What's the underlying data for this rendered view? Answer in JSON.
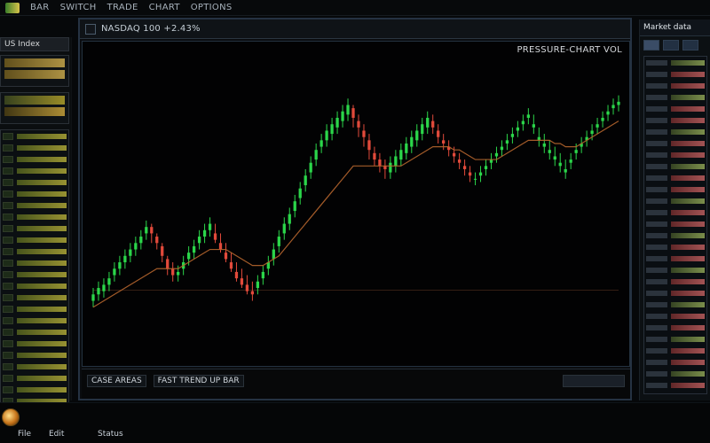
{
  "menubar": {
    "items": [
      "BAR",
      "SWITCH",
      "TRADE",
      "CHART",
      "OPTIONS"
    ]
  },
  "left_panel": {
    "header": "US Index",
    "watchlist_rows": 24
  },
  "chart_window": {
    "title": "NASDAQ 100  +2.43%",
    "overlay_label": "PRESSURE-CHART VOL",
    "footer_left": "CASE AREAS",
    "footer_mid": "FAST TREND UP BAR",
    "footer_right": ""
  },
  "right_panel": {
    "header": "Market data",
    "tab_count": 3,
    "rows": 29
  },
  "taskbar": {
    "items": [
      "File",
      "Edit",
      "Status"
    ]
  },
  "colors": {
    "bull": "#2bd64a",
    "bear": "#e24a3b",
    "ma": "#b5652e",
    "base": "#4a2a1b",
    "window_border": "#253242"
  },
  "chart_data": {
    "type": "candlestick",
    "x": [
      1,
      2,
      3,
      4,
      5,
      6,
      7,
      8,
      9,
      10,
      11,
      12,
      13,
      14,
      15,
      16,
      17,
      18,
      19,
      20,
      21,
      22,
      23,
      24,
      25,
      26,
      27,
      28,
      29,
      30,
      31,
      32,
      33,
      34,
      35,
      36,
      37,
      38,
      39,
      40,
      41,
      42,
      43,
      44,
      45,
      46,
      47,
      48,
      49,
      50,
      51,
      52,
      53,
      54,
      55,
      56,
      57,
      58,
      59,
      60,
      61,
      62,
      63,
      64,
      65,
      66,
      67,
      68,
      69,
      70,
      71,
      72,
      73,
      74,
      75,
      76,
      77,
      78,
      79,
      80,
      81,
      82,
      83,
      84,
      85,
      86,
      87,
      88,
      89,
      90,
      91,
      92,
      93,
      94,
      95,
      96,
      97,
      98,
      99,
      100
    ],
    "open": [
      42,
      44,
      45,
      47,
      50,
      52,
      54,
      56,
      58,
      60,
      63,
      65,
      62,
      59,
      55,
      52,
      50,
      52,
      55,
      57,
      60,
      62,
      64,
      63,
      60,
      57,
      54,
      51,
      49,
      47,
      45,
      46,
      49,
      52,
      55,
      59,
      63,
      66,
      70,
      74,
      78,
      82,
      86,
      90,
      92,
      94,
      96,
      98,
      100,
      102,
      98,
      95,
      92,
      88,
      86,
      84,
      82,
      84,
      86,
      88,
      90,
      92,
      94,
      96,
      98,
      95,
      92,
      90,
      88,
      86,
      84,
      82,
      80,
      81,
      83,
      85,
      87,
      89,
      91,
      93,
      95,
      97,
      99,
      96,
      92,
      90,
      88,
      86,
      84,
      82,
      85,
      88,
      90,
      92,
      94,
      96,
      98,
      100,
      102,
      103
    ],
    "close": [
      44,
      46,
      47,
      49,
      52,
      54,
      56,
      58,
      60,
      62,
      65,
      63,
      60,
      56,
      52,
      50,
      51,
      54,
      57,
      59,
      62,
      64,
      66,
      61,
      58,
      55,
      52,
      49,
      47,
      45,
      44,
      48,
      51,
      54,
      58,
      62,
      66,
      69,
      73,
      77,
      81,
      85,
      89,
      92,
      95,
      97,
      99,
      101,
      103,
      99,
      96,
      93,
      89,
      86,
      84,
      83,
      85,
      87,
      89,
      91,
      93,
      95,
      97,
      99,
      96,
      93,
      91,
      89,
      87,
      85,
      83,
      81,
      80,
      82,
      84,
      86,
      88,
      90,
      92,
      94,
      96,
      98,
      100,
      97,
      93,
      91,
      89,
      87,
      85,
      83,
      86,
      89,
      91,
      93,
      95,
      97,
      99,
      101,
      103,
      104
    ],
    "high": [
      46,
      48,
      49,
      51,
      54,
      56,
      58,
      60,
      62,
      64,
      67,
      66,
      63,
      60,
      56,
      54,
      53,
      56,
      59,
      61,
      64,
      66,
      68,
      66,
      63,
      60,
      57,
      54,
      52,
      50,
      48,
      50,
      53,
      56,
      60,
      64,
      68,
      71,
      75,
      79,
      83,
      87,
      91,
      94,
      97,
      99,
      101,
      103,
      105,
      103,
      100,
      97,
      94,
      90,
      88,
      86,
      87,
      89,
      91,
      93,
      95,
      97,
      99,
      101,
      100,
      97,
      94,
      92,
      90,
      88,
      86,
      84,
      82,
      84,
      86,
      88,
      90,
      92,
      94,
      96,
      98,
      100,
      102,
      100,
      96,
      94,
      92,
      90,
      88,
      86,
      88,
      91,
      93,
      95,
      97,
      99,
      101,
      103,
      105,
      106
    ],
    "low": [
      40,
      42,
      43,
      45,
      48,
      50,
      52,
      54,
      56,
      58,
      61,
      60,
      58,
      54,
      50,
      48,
      48,
      50,
      53,
      55,
      58,
      60,
      62,
      60,
      57,
      54,
      51,
      48,
      46,
      44,
      42,
      44,
      47,
      50,
      53,
      57,
      61,
      64,
      68,
      72,
      76,
      80,
      84,
      88,
      90,
      92,
      94,
      96,
      98,
      96,
      93,
      90,
      86,
      84,
      82,
      80,
      80,
      82,
      84,
      86,
      88,
      90,
      92,
      94,
      94,
      91,
      89,
      87,
      85,
      83,
      81,
      79,
      78,
      79,
      81,
      83,
      85,
      87,
      89,
      91,
      93,
      95,
      97,
      94,
      90,
      88,
      86,
      84,
      82,
      80,
      83,
      86,
      88,
      90,
      92,
      94,
      96,
      98,
      100,
      101
    ],
    "ma": [
      40,
      41,
      42,
      43,
      44,
      45,
      46,
      47,
      48,
      49,
      50,
      51,
      52,
      52,
      52,
      52,
      52,
      53,
      54,
      55,
      56,
      57,
      58,
      58,
      58,
      58,
      57,
      56,
      55,
      54,
      53,
      53,
      53,
      54,
      55,
      56,
      58,
      60,
      62,
      64,
      66,
      68,
      70,
      72,
      74,
      76,
      78,
      80,
      82,
      84,
      84,
      84,
      84,
      84,
      84,
      84,
      84,
      84,
      84,
      85,
      86,
      87,
      88,
      89,
      90,
      90,
      90,
      90,
      89,
      89,
      88,
      87,
      86,
      86,
      86,
      86,
      86,
      87,
      88,
      89,
      90,
      91,
      92,
      92,
      92,
      92,
      92,
      91,
      91,
      90,
      90,
      90,
      91,
      92,
      93,
      94,
      95,
      96,
      97,
      98
    ],
    "ylim": [
      30,
      115
    ]
  }
}
